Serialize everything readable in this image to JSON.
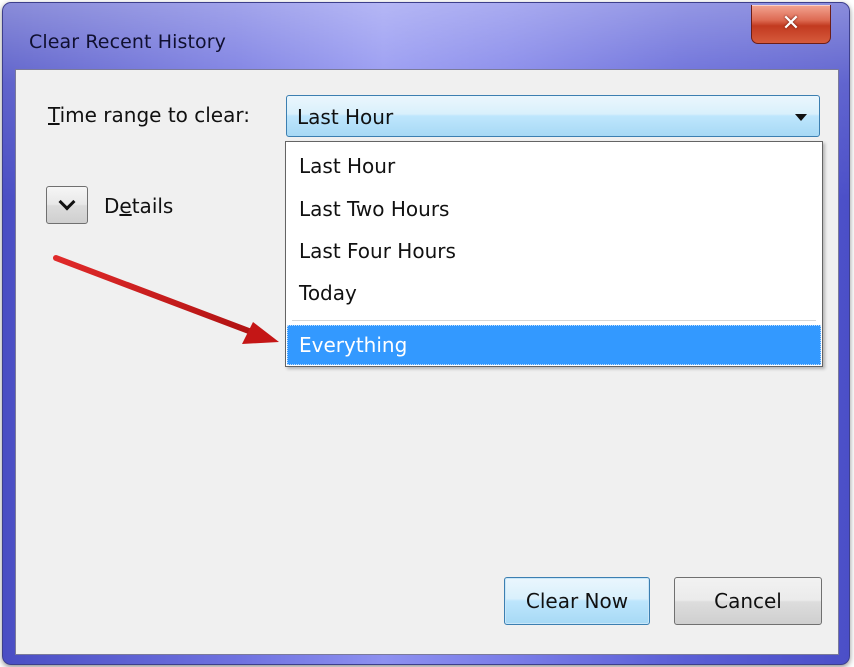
{
  "window": {
    "title": "Clear Recent History",
    "close_glyph": "✕"
  },
  "time_range": {
    "label_prefix": "T",
    "label_rest": "ime range to clear:",
    "selected_value": "Last Hour",
    "options": [
      "Last Hour",
      "Last Two Hours",
      "Last Four Hours",
      "Today",
      "Everything"
    ],
    "highlighted_option": "Everything"
  },
  "details": {
    "label_pre": "D",
    "label_mnemonic": "e",
    "label_post": "tails"
  },
  "buttons": {
    "clear_now": "Clear Now",
    "cancel": "Cancel"
  },
  "annotation": {
    "arrow_color": "#cc1a1a"
  },
  "colors": {
    "highlight": "#3399ff",
    "window_frame": "#6f72e0"
  }
}
